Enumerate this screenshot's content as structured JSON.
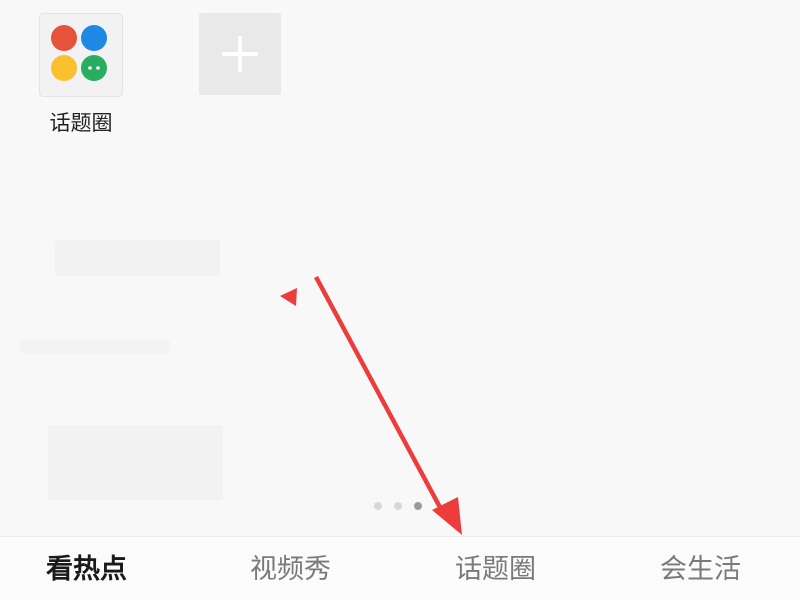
{
  "apps": {
    "topic_circle": {
      "label": "话题圈",
      "icon": "four-color-dots-chat-icon",
      "colors": [
        "#e5533d",
        "#1e88e5",
        "#fbc02d",
        "#27ae60"
      ]
    },
    "add_button": {
      "icon": "plus-icon"
    }
  },
  "pager": {
    "pages": 3,
    "active_index": 2
  },
  "tabbar": {
    "tabs": [
      {
        "label": "看热点",
        "active": true
      },
      {
        "label": "视频秀",
        "active": false
      },
      {
        "label": "话题圈",
        "active": false
      },
      {
        "label": "会生活",
        "active": false
      }
    ]
  },
  "annotation": {
    "color": "#ee3b3b"
  }
}
